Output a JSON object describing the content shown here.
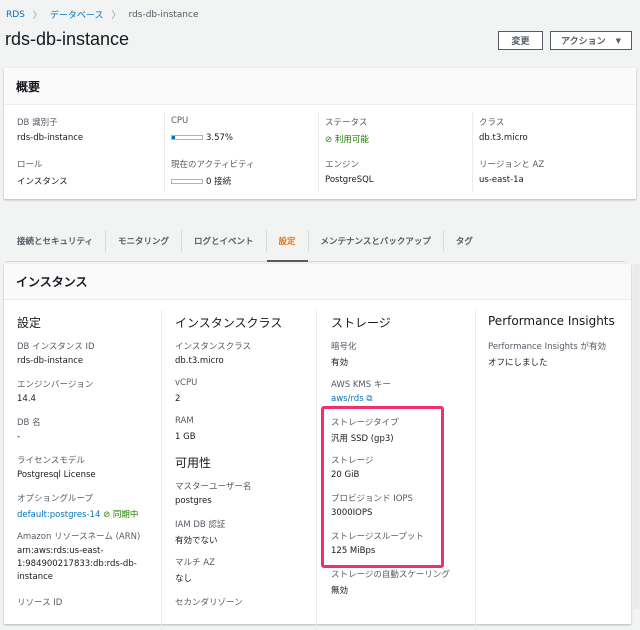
{
  "breadcrumb": [
    "RDS",
    "データベース",
    "rds-db-instance"
  ],
  "title": "rds-db-instance",
  "buttons": {
    "modify": "変更",
    "actions": "アクション"
  },
  "summary": {
    "heading": "概要",
    "db_id_label": "DB 識別子",
    "db_id": "rds-db-instance",
    "cpu_label": "CPU",
    "cpu": "3.57%",
    "cpu_fraction": 0.0357,
    "status_label": "ステータス",
    "status": "利用可能",
    "class_label": "クラス",
    "class": "db.t3.micro",
    "role_label": "ロール",
    "role": "インスタンス",
    "activity_label": "現在のアクティビティ",
    "activity": "0 接続",
    "engine_label": "エンジン",
    "engine": "PostgreSQL",
    "region_label": "リージョンと AZ",
    "region": "us-east-1a"
  },
  "tabs": [
    "接続とセキュリティ",
    "モニタリング",
    "ログとイベント",
    "設定",
    "メンテナンスとバックアップ",
    "タグ"
  ],
  "active_tab": "設定",
  "instance": {
    "heading": "インスタンス",
    "config": {
      "heading": "設定",
      "fields": [
        {
          "label": "DB インスタンス ID",
          "value": "rds-db-instance"
        },
        {
          "label": "エンジンバージョン",
          "value": "14.4"
        },
        {
          "label": "DB 名",
          "value": "-"
        },
        {
          "label": "ライセンスモデル",
          "value": "Postgresql License"
        }
      ],
      "option_group_label": "オプショングループ",
      "option_group": "default:postgres-14",
      "option_group_status": "同期中",
      "arn_label": "Amazon リソースネーム (ARN)",
      "arn": [
        "arn:aws:rds:us-east-",
        "1:984900217833:db:rds-db-",
        "instance"
      ],
      "resource_id_label": "リソース ID"
    },
    "class": {
      "heading": "インスタンスクラス",
      "fields": [
        {
          "label": "インスタンスクラス",
          "value": "db.t3.micro"
        },
        {
          "label": "vCPU",
          "value": "2"
        },
        {
          "label": "RAM",
          "value": "1 GB"
        }
      ]
    },
    "availability": {
      "heading": "可用性",
      "fields": [
        {
          "label": "マスターユーザー名",
          "value": "postgres"
        },
        {
          "label": "IAM DB 認証",
          "value": "有効でない"
        },
        {
          "label": "マルチ AZ",
          "value": "なし"
        }
      ],
      "secondary_label": "セカンダリゾーン"
    },
    "storage": {
      "heading": "ストレージ",
      "encryption_label": "暗号化",
      "encryption": "有効",
      "kms_label": "AWS KMS キー",
      "kms": "aws/rds",
      "fields": [
        {
          "label": "ストレージタイプ",
          "value": "汎用 SSD (gp3)"
        },
        {
          "label": "ストレージ",
          "value": "20 GiB"
        },
        {
          "label": "プロビジョンド IOPS",
          "value": "3000IOPS"
        },
        {
          "label": "ストレージスループット",
          "value": "125 MiBps"
        },
        {
          "label": "ストレージの自動スケーリング",
          "value": "無効"
        }
      ]
    },
    "pi": {
      "heading": "Performance Insights",
      "label": "Performance Insights が有効",
      "value": "オフにしました"
    }
  },
  "colors": {
    "link": "#0073bb",
    "active_tab": "#ec7211",
    "success": "#1d8102",
    "highlight": "#f0306e"
  }
}
